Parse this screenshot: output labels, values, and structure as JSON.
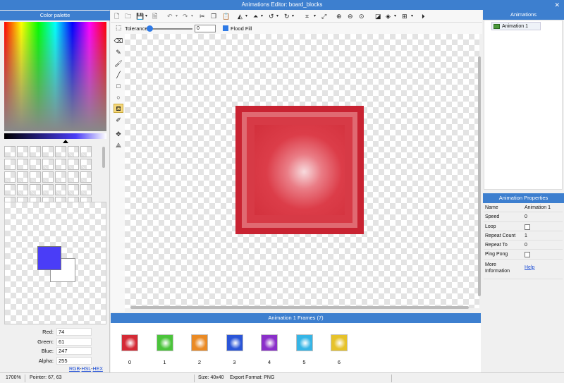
{
  "window": {
    "title": "Animations Editor: board_blocks"
  },
  "color_panel": {
    "title": "Color palette",
    "current_color": "#4a3df7",
    "rgba": [
      {
        "label": "Red:",
        "value": "74"
      },
      {
        "label": "Green:",
        "value": "61"
      },
      {
        "label": "Blue:",
        "value": "247"
      },
      {
        "label": "Alpha:",
        "value": "255"
      }
    ],
    "modes": {
      "rgb": "RGB",
      "sep": "-",
      "hsl": "HSL",
      "hex": "HEX"
    }
  },
  "toolbar": {
    "icons": [
      "new-file-icon",
      "open-folder-icon",
      "save-icon",
      "export-icon",
      "undo-icon",
      "redo-icon",
      "cut-icon",
      "copy-icon",
      "paste-icon",
      "flip-horizontal-icon",
      "flip-vertical-icon",
      "rotate-left-icon",
      "rotate-right-icon",
      "crop-icon",
      "resize-icon",
      "zoom-in-icon",
      "zoom-out-icon",
      "zoom-reset-icon",
      "color-adjust-icon",
      "layers-icon",
      "grid-icon",
      "play-icon"
    ]
  },
  "options": {
    "tolerance_label": "Tolerance",
    "tolerance_value": "0",
    "flood_fill_label": "Flood Fill",
    "flood_fill_checked": true
  },
  "tools": [
    "select-tool",
    "eraser-tool",
    "pencil-tool",
    "brush-tool",
    "line-tool",
    "rectangle-tool",
    "ellipse-tool",
    "fill-tool",
    "color-picker-tool",
    "move-point-tool",
    "transform-tool"
  ],
  "frames_panel": {
    "title": "Animation 1 Frames (7)",
    "frames": [
      {
        "label": "0",
        "color": "#d42a35"
      },
      {
        "label": "1",
        "color": "#4bc43b"
      },
      {
        "label": "2",
        "color": "#ea8a24"
      },
      {
        "label": "3",
        "color": "#2a55d8"
      },
      {
        "label": "4",
        "color": "#8a2fc9"
      },
      {
        "label": "5",
        "color": "#35b5e6"
      },
      {
        "label": "6",
        "color": "#e6c22a"
      }
    ]
  },
  "animations_panel": {
    "title": "Animations",
    "items": [
      {
        "label": "Animation 1"
      }
    ]
  },
  "properties_panel": {
    "title": "Animation Properties",
    "rows": [
      {
        "key": "Name",
        "value": "Animation 1"
      },
      {
        "key": "Speed",
        "value": "0"
      },
      {
        "key": "Loop",
        "checkbox": true
      },
      {
        "key": "Repeat Count",
        "value": "1"
      },
      {
        "key": "Repeat To",
        "value": "0"
      },
      {
        "key": "Ping Pong",
        "checkbox": true
      },
      {
        "key": "More Information",
        "link": "Help"
      }
    ]
  },
  "status": {
    "zoom": "1700%",
    "pointer": "Pointer: 67, 63",
    "size": "Size: 40x40",
    "format": "Export Format: PNG"
  },
  "canvas": {
    "block_color": "#c92332"
  }
}
